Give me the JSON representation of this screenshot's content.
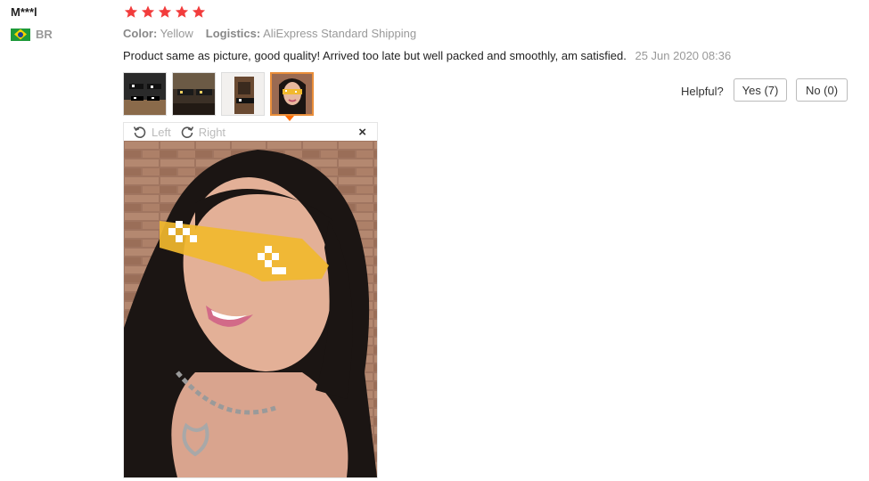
{
  "reviewer": {
    "name": "M***l",
    "country_code": "BR",
    "flag_icon": "brazil-flag-icon"
  },
  "rating": {
    "stars": 5,
    "max": 5,
    "star_color": "#f23c3c"
  },
  "attributes": {
    "color_label": "Color:",
    "color_value": "Yellow",
    "logistics_label": "Logistics:",
    "logistics_value": "AliExpress Standard Shipping"
  },
  "review": {
    "text": "Product same as picture, good quality! Arrived too late but well packed and smoothly, am satisfied.",
    "date": "25 Jun 2020 08:36"
  },
  "photos": {
    "thumbnails": [
      "photo-1",
      "photo-2",
      "photo-3",
      "photo-4"
    ],
    "active_index": 3,
    "active_border_color": "#e98e3a"
  },
  "helpful": {
    "label": "Helpful?",
    "yes_label": "Yes (7)",
    "no_label": "No (0)"
  },
  "viewer": {
    "rotate_left_label": "Left",
    "rotate_right_label": "Right",
    "rotate_left_icon": "rotate-left-icon",
    "rotate_right_icon": "rotate-right-icon",
    "close_icon": "close-icon",
    "close_glyph": "×"
  }
}
